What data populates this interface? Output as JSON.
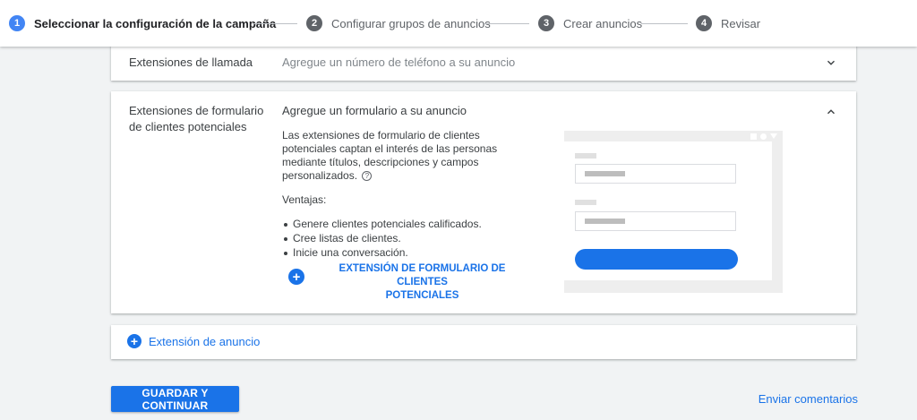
{
  "stepper": {
    "steps": [
      {
        "number": "1",
        "label": "Seleccionar la configuración de la campaña"
      },
      {
        "number": "2",
        "label": "Configurar grupos de anuncios"
      },
      {
        "number": "3",
        "label": "Crear anuncios"
      },
      {
        "number": "4",
        "label": "Revisar"
      }
    ],
    "active_step": 1
  },
  "call_extension": {
    "label": "Extensiones de llamada",
    "summary": "Agregue un número de teléfono a su anuncio",
    "expanded": false
  },
  "lead_form_extension": {
    "label": "Extensiones de formulario de clientes potenciales",
    "summary": "Agregue un formulario a su anuncio",
    "description": "Las extensiones de formulario de clientes potenciales captan el interés de las personas mediante títulos, descripciones y campos personalizados.",
    "help_glyph": "?",
    "benefits_title": "Ventajas:",
    "benefits": [
      "Genere clientes potenciales calificados.",
      "Cree listas de clientes.",
      "Inicie una conversación."
    ],
    "add_button_line1": "EXTENSIÓN DE FORMULARIO DE CLIENTES",
    "add_button_line2": "POTENCIALES",
    "expanded": true
  },
  "ad_extension": {
    "label": "Extensión de anuncio"
  },
  "footer": {
    "save_label": "GUARDAR Y CONTINUAR",
    "feedback_label": "Enviar comentarios"
  },
  "colors": {
    "accent": "#1a73e8",
    "active_step": "#4285f4",
    "background": "#f1f3f4"
  },
  "icons": {
    "add": "plus-circle-icon",
    "collapse": "chevron-up-icon",
    "expand": "chevron-down-icon",
    "help": "help-circle-icon"
  }
}
